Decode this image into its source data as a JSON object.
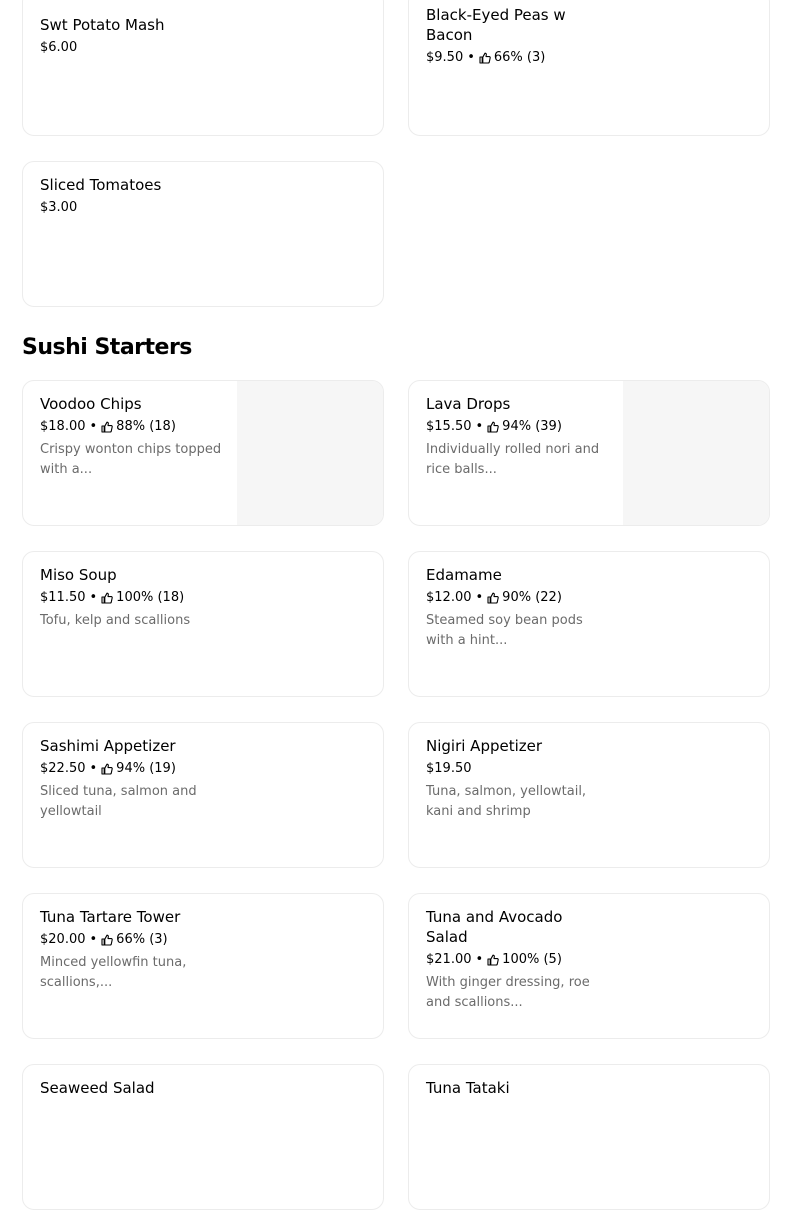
{
  "items": [
    {
      "name": "Swt Potato Mash",
      "price": "$6.00"
    },
    {
      "name": "Black-Eyed Peas w Bacon",
      "price": "$9.50",
      "rating": "66% (3)"
    },
    {
      "name": "Sliced Tomatoes",
      "price": "$3.00"
    }
  ],
  "section": {
    "title": "Sushi Starters"
  },
  "sushi": [
    {
      "name": "Voodoo Chips",
      "price": "$18.00",
      "rating": "88% (18)",
      "desc": "Crispy wonton chips topped with a..."
    },
    {
      "name": "Lava Drops",
      "price": "$15.50",
      "rating": "94% (39)",
      "desc": "Individually rolled nori and rice balls..."
    },
    {
      "name": "Miso Soup",
      "price": "$11.50",
      "rating": "100% (18)",
      "desc": "Tofu, kelp and scallions"
    },
    {
      "name": "Edamame",
      "price": "$12.00",
      "rating": "90% (22)",
      "desc": "Steamed soy bean pods with a hint..."
    },
    {
      "name": "Sashimi Appetizer",
      "price": "$22.50",
      "rating": "94% (19)",
      "desc": "Sliced tuna, salmon and yellowtail"
    },
    {
      "name": "Nigiri Appetizer",
      "price": "$19.50",
      "desc": "Tuna, salmon, yellowtail, kani and shrimp"
    },
    {
      "name": "Tuna Tartare Tower",
      "price": "$20.00",
      "rating": "66% (3)",
      "desc": "Minced yellowfin tuna, scallions,..."
    },
    {
      "name": "Tuna and Avocado Salad",
      "price": "$21.00",
      "rating": "100% (5)",
      "desc": "With ginger dressing, roe and scallions..."
    },
    {
      "name": "Seaweed Salad"
    },
    {
      "name": "Tuna Tataki"
    }
  ],
  "separator": "•",
  "icons": {
    "rating": "thumbs-up-icon"
  }
}
